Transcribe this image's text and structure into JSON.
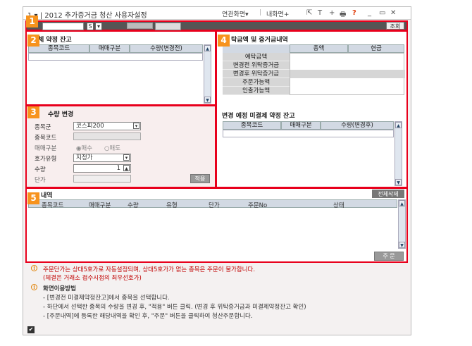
{
  "window": {
    "title": "1 ▾ | 2012 추가증거금 청산 사용자설정",
    "links": [
      "연관화면▾",
      "내화면+"
    ],
    "icons": [
      "screen-link-icon",
      "text-icon",
      "add-icon",
      "print-icon",
      "help-icon",
      "minimize-icon",
      "restore-icon",
      "close-icon"
    ],
    "icon_glyphs": [
      "⇱",
      "T",
      "+",
      "🖶",
      "?",
      "_",
      "▭",
      "✕"
    ]
  },
  "toolbar": {
    "s_label": "S",
    "dropdown_arrow": "▾",
    "query_button": "조회"
  },
  "section1": {
    "badge": "1"
  },
  "section2": {
    "badge": "2",
    "title": "체 약정 잔고",
    "columns": [
      "종목코드",
      "매매구분",
      "수량(변경전)"
    ]
  },
  "section3": {
    "badge": "3",
    "title": "수량 변경",
    "labels": [
      "종목군",
      "종목코드",
      "매매구분",
      "호가유형",
      "수량",
      "단가"
    ],
    "market_group": "코스피200",
    "trade_options": [
      "◉매수",
      "○매도"
    ],
    "order_type": "지정가",
    "quantity": "1",
    "apply_button": "적용"
  },
  "section4": {
    "badge": "4",
    "title": "탁금액 및 증거금내역",
    "columns": [
      "총액",
      "현금"
    ],
    "rows": [
      "예탁금액",
      "변경전 위탁증거금",
      "변경후 위탁증거금",
      "주문가능액",
      "인출가능액"
    ],
    "subtitle": "변경 예정 미결제 약정 잔고",
    "columns2": [
      "종목코드",
      "매매구분",
      "수량(변경후)"
    ]
  },
  "section5": {
    "badge": "5",
    "title": "내역",
    "delete_all_button": "전체삭제",
    "columns": [
      "종목코드",
      "매매구분",
      "수량",
      "유형",
      "단가",
      "주문No",
      "상태"
    ],
    "order_button": "주 문"
  },
  "notes": {
    "warn1": "주문단가는 상대5호가로 자동설정되며, 상대5호가가 없는 종목은 주문이 불가합니다.",
    "warn1_sub": "(체결은 거래소 접수시점의 최우선호가)",
    "usage_title": "화면이용방법",
    "usage_lines": [
      "- [변경전 미결제약정잔고]에서 종목을 선택합니다.",
      "- 하단에서 선택한 종목의 수량을 변경 후, \"적용\" 버튼 클릭. (변경 후 위탁증거금과 미결제약정잔고 확인)",
      "- [주문내역]에 등록한 해당내역을 확인 후, \"주문\" 버튼을 클릭하여 청산주문합니다."
    ]
  },
  "scroll": {
    "up": "▲",
    "down": "▼"
  },
  "colors": {
    "highlight_border": "#e8001c",
    "badge": "#f7931d",
    "header": "#d2d9e3",
    "warn_text": "#c00000"
  }
}
